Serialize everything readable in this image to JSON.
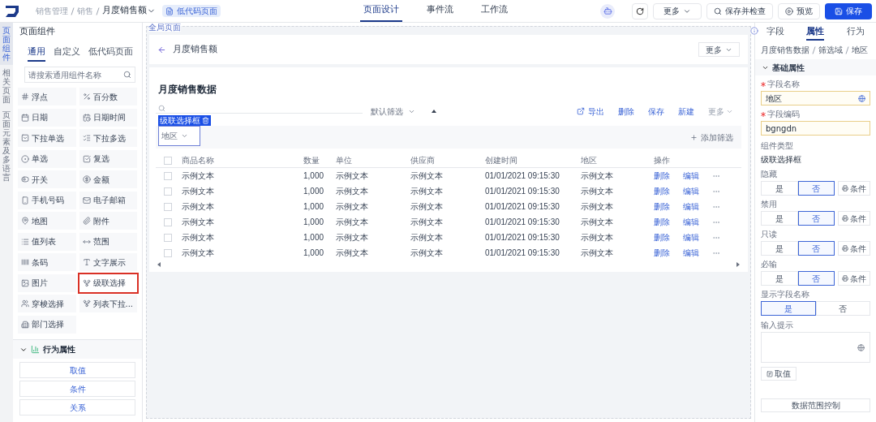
{
  "topbar": {
    "breadcrumb": [
      "销售管理",
      "销售"
    ],
    "page_title": "月度销售额",
    "page_type": "低代码页面",
    "tabs": [
      {
        "label": "页面设计",
        "selected": true
      },
      {
        "label": "事件流",
        "selected": false
      },
      {
        "label": "工作流",
        "selected": false
      }
    ],
    "buttons": [
      {
        "label": "更多",
        "kind": "dropdown"
      },
      {
        "label": "保存并检查",
        "kind": "check"
      },
      {
        "label": "预览",
        "kind": "preview"
      },
      {
        "label": "保存",
        "kind": "primary"
      }
    ]
  },
  "side_tabs": [
    {
      "label": "页面组件",
      "selected": true
    },
    {
      "label": "相关页面",
      "selected": false
    },
    {
      "label": "页面元素及多语言",
      "selected": false
    }
  ],
  "components_panel": {
    "title": "页面组件",
    "tabs": [
      {
        "label": "通用",
        "selected": true
      },
      {
        "label": "自定义",
        "selected": false
      },
      {
        "label": "低代码页面",
        "selected": false
      }
    ],
    "search": {
      "placeholder": "请搜索通用组件名称"
    },
    "items": [
      {
        "label": "浮点",
        "selected": false
      },
      {
        "label": "百分数",
        "selected": false
      },
      {
        "label": "日期",
        "selected": false
      },
      {
        "label": "日期时间",
        "selected": false
      },
      {
        "label": "下拉单选",
        "selected": false
      },
      {
        "label": "下拉多选",
        "selected": false
      },
      {
        "label": "单选",
        "selected": false
      },
      {
        "label": "复选",
        "selected": false
      },
      {
        "label": "开关",
        "selected": false
      },
      {
        "label": "金额",
        "selected": false
      },
      {
        "label": "手机号码",
        "selected": false
      },
      {
        "label": "电子邮箱",
        "selected": false
      },
      {
        "label": "地图",
        "selected": false
      },
      {
        "label": "附件",
        "selected": false
      },
      {
        "label": "值列表",
        "selected": false
      },
      {
        "label": "范围",
        "selected": false
      },
      {
        "label": "条码",
        "selected": false
      },
      {
        "label": "文字展示",
        "selected": false
      },
      {
        "label": "图片",
        "selected": false
      },
      {
        "label": "级联选择",
        "selected": true
      },
      {
        "label": "穿梭选择",
        "selected": false
      },
      {
        "label": "列表下拉...",
        "selected": false
      },
      {
        "label": "部门选择",
        "selected": false
      }
    ],
    "behavior": {
      "title": "行为属性",
      "expanded": true,
      "buttons": [
        "取值",
        "条件",
        "关系"
      ]
    }
  },
  "canvas": {
    "label": "全局页面",
    "header": {
      "back_title": "月度销售额",
      "more": "更多"
    },
    "table_section": {
      "title": "月度销售数据",
      "filter": "默认筛选",
      "actions": [
        {
          "label": "导出",
          "kind": "export",
          "disabled": false
        },
        {
          "label": "删除",
          "kind": "link",
          "disabled": false
        },
        {
          "label": "保存",
          "kind": "link",
          "disabled": false
        },
        {
          "label": "新建",
          "kind": "link",
          "disabled": false
        },
        {
          "label": "更多",
          "kind": "dropdown",
          "disabled": true
        }
      ],
      "selected_tag": "级联选择框",
      "cascade_field": {
        "placeholder": "地区"
      },
      "add_filter": "添加筛选",
      "select_all": {
        "checked": false
      },
      "columns": [
        "商品名称",
        "数量",
        "单位",
        "供应商",
        "创建时间",
        "地区",
        "操作"
      ],
      "rows": [
        {
          "checked": false,
          "cells": [
            "示例文本",
            "1,000",
            "示例文本",
            "示例文本",
            "01/01/2021 09:15:30",
            "示例文本"
          ],
          "actions": [
            "删除",
            "编辑"
          ]
        },
        {
          "checked": false,
          "cells": [
            "示例文本",
            "1,000",
            "示例文本",
            "示例文本",
            "01/01/2021 09:15:30",
            "示例文本"
          ],
          "actions": [
            "删除",
            "编辑"
          ]
        },
        {
          "checked": false,
          "cells": [
            "示例文本",
            "1,000",
            "示例文本",
            "示例文本",
            "01/01/2021 09:15:30",
            "示例文本"
          ],
          "actions": [
            "删除",
            "编辑"
          ]
        },
        {
          "checked": false,
          "cells": [
            "示例文本",
            "1,000",
            "示例文本",
            "示例文本",
            "01/01/2021 09:15:30",
            "示例文本"
          ],
          "actions": [
            "删除",
            "编辑"
          ]
        },
        {
          "checked": false,
          "cells": [
            "示例文本",
            "1,000",
            "示例文本",
            "示例文本",
            "01/01/2021 09:15:30",
            "示例文本"
          ],
          "actions": [
            "删除",
            "编辑"
          ]
        },
        {
          "checked": false,
          "cells": [
            "示例文本",
            "1,000",
            "示例文本",
            "示例文本",
            "01/01/2021 09:15:30",
            "示例文本"
          ],
          "actions": [
            "删除",
            "编辑"
          ]
        }
      ]
    }
  },
  "properties_panel": {
    "tabs": [
      {
        "label": "字段",
        "selected": false
      },
      {
        "label": "属性",
        "selected": true
      },
      {
        "label": "行为",
        "selected": false
      }
    ],
    "breadcrumb": [
      "月度销售数据",
      "筛选域",
      "地区"
    ],
    "section": {
      "title": "基础属性",
      "expanded": true
    },
    "inputs": [
      {
        "label": "字段名称",
        "value": "地区",
        "required": true,
        "kind": "multilang"
      },
      {
        "label": "字段编码",
        "value": "bgngdn",
        "required": true,
        "kind": "text"
      }
    ],
    "component_type": {
      "label": "组件类型",
      "value": "级联选择框"
    },
    "toggles": [
      {
        "label": "隐藏",
        "options": [
          {
            "label": "是",
            "selected": false
          },
          {
            "label": "否",
            "selected": true
          }
        ],
        "condition": "条件"
      },
      {
        "label": "禁用",
        "options": [
          {
            "label": "是",
            "selected": false
          },
          {
            "label": "否",
            "selected": true
          }
        ],
        "condition": "条件"
      },
      {
        "label": "只读",
        "options": [
          {
            "label": "是",
            "selected": false
          },
          {
            "label": "否",
            "selected": true
          }
        ],
        "condition": "条件"
      },
      {
        "label": "必输",
        "options": [
          {
            "label": "是",
            "selected": false
          },
          {
            "label": "否",
            "selected": true
          }
        ],
        "condition": "条件"
      },
      {
        "label": "显示字段名称",
        "options": [
          {
            "label": "是",
            "selected": true
          },
          {
            "label": "否",
            "selected": false
          }
        ]
      }
    ],
    "hint": {
      "label": "输入提示"
    },
    "value_button": "取值",
    "data_scope": "数据范围控制"
  }
}
